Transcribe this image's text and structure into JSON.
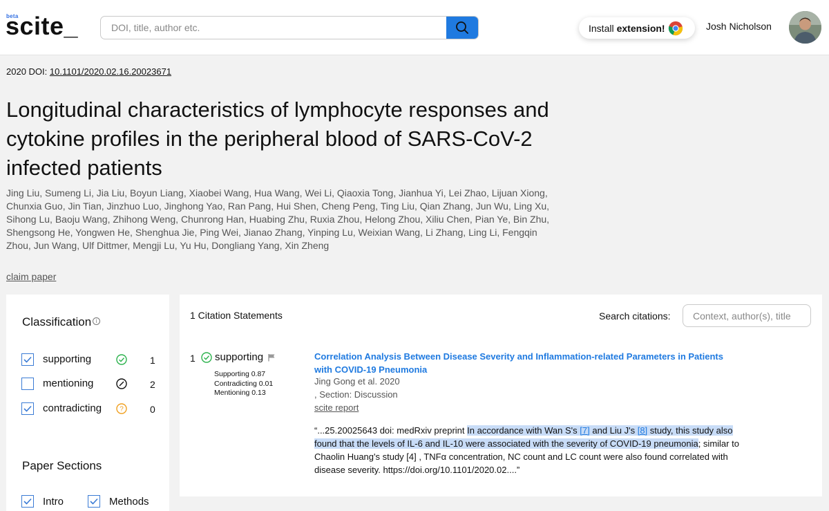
{
  "header": {
    "logo_beta": "beta",
    "logo_text": "scite_",
    "search_placeholder": "DOI, title, author etc.",
    "install_prefix": "Install",
    "install_bold": "extension!",
    "user_name": "Josh Nicholson"
  },
  "paper": {
    "year_doi_prefix": "2020 DOI:",
    "doi": "10.1101/2020.02.16.20023671",
    "title": "Longitudinal characteristics of lymphocyte responses and cytokine profiles in the peripheral blood of SARS-CoV-2 infected patients",
    "authors": "Jing Liu, Sumeng Li, Jia Liu, Boyun Liang, Xiaobei Wang, Hua Wang, Wei Li, Qiaoxia Tong, Jianhua Yi, Lei Zhao, Lijuan Xiong, Chunxia Guo, Jin Tian, Jinzhuo Luo, Jinghong Yao, Ran Pang, Hui Shen, Cheng Peng, Ting Liu, Qian Zhang, Jun Wu, Ling Xu, Sihong Lu, Baoju Wang, Zhihong Weng, Chunrong Han, Huabing Zhu, Ruxia Zhou, Helong Zhou, Xiliu Chen, Pian Ye, Bin Zhu, Shengsong He, Yongwen He, Shenghua Jie, Ping Wei, Jianao Zhang, Yinping Lu, Weixian Wang, Li Zhang, Ling Li, Fengqin Zhou, Jun Wang, Ulf Dittmer, Mengji Lu, Yu Hu, Dongliang Yang, Xin Zheng",
    "claim_link": "claim paper"
  },
  "classification": {
    "heading": "Classification",
    "info_glyph": "i",
    "items": [
      {
        "label": "supporting",
        "count": "1",
        "checked": true,
        "icon": "check-circle-icon",
        "color": "#2bb24c"
      },
      {
        "label": "mentioning",
        "count": "2",
        "checked": false,
        "icon": "slash-circle-icon",
        "color": "#111111"
      },
      {
        "label": "contradicting",
        "count": "0",
        "checked": true,
        "icon": "question-circle-icon",
        "color": "#f0a020"
      }
    ]
  },
  "sections": {
    "heading": "Paper Sections",
    "items": [
      {
        "label": "Intro",
        "checked": true
      },
      {
        "label": "Methods",
        "checked": true
      }
    ]
  },
  "citations": {
    "count_label": "1 Citation Statements",
    "search_label": "Search citations:",
    "search_placeholder": "Context, author(s), title",
    "statement": {
      "number": "1",
      "tag": "supporting",
      "scores": [
        "Supporting 0.87",
        "Contradicting 0.01",
        "Mentioning 0.13"
      ],
      "title": "Correlation Analysis Between Disease Severity and Inflammation-related Parameters in Patients with COVID-19 Pneumonia",
      "authors_year": "Jing Gong et al. 2020",
      "section": ", Section: Discussion",
      "report_link": "scite report",
      "quote_pre": "“...25.20025643 doi: medRxiv preprint ",
      "quote_hl_1": "In accordance with Wan S's ",
      "ref_1": "[7]",
      "quote_hl_2": " and Liu J's ",
      "ref_2": "[8]",
      "quote_hl_3": " study, this study also found that the levels of IL-6 and IL-10 were associated with the severity of COVID-19 pneumonia",
      "quote_post": "; similar to Chaolin Huang's study [4] , TNFα concentration, NC count and LC count were also found correlated with disease severity. https://doi.org/10.1101/2020.02....”"
    }
  },
  "colors": {
    "accent": "#1f7ae0",
    "highlight": "#c8dcf7",
    "supporting": "#2bb24c",
    "contradicting": "#f0a020"
  }
}
